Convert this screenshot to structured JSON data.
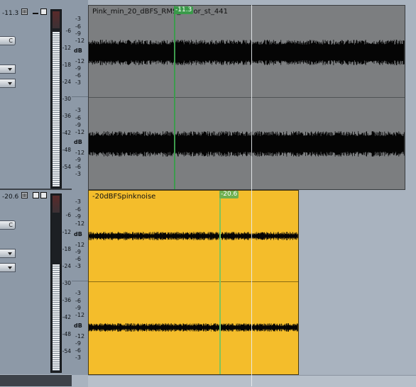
{
  "tracks": [
    {
      "volume": "-11.3",
      "clip_name": "Pink_min_20_dBFS_RMS_uncor_st_441",
      "cursor_value": "-11.3",
      "color": "#7c7e80"
    },
    {
      "volume": "-20.6",
      "clip_name": "-20dBFSpinknoise",
      "cursor_value": "-20.6",
      "color": "#f4bd2b"
    }
  ],
  "header": {
    "c_button": "C"
  },
  "meter_scale": [
    "-6",
    "-12",
    "-18",
    "-24",
    "-30",
    "-36",
    "-42",
    "-48",
    "-54"
  ],
  "db_scale": {
    "upper": [
      "-3",
      "-6",
      "-9",
      "-12",
      "dB",
      "-12",
      "-9",
      "-6",
      "-3"
    ],
    "lower": [
      "-3",
      "-6",
      "-9",
      "-12",
      "dB",
      "-12",
      "-9",
      "-6",
      "-3"
    ]
  },
  "icons": [
    "meter-bars-icon",
    "minimize-icon",
    "maximize-icon",
    "dropdown-arrow-icon"
  ]
}
